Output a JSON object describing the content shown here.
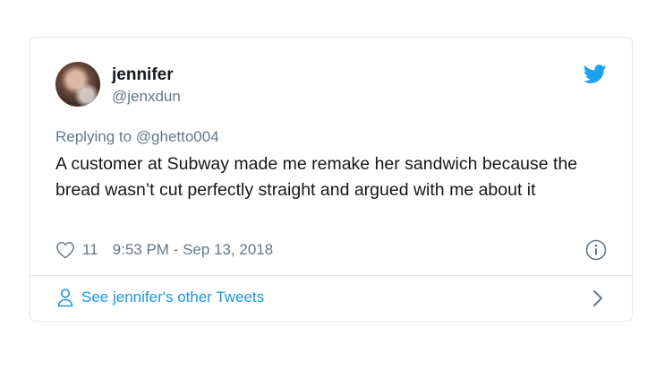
{
  "user": {
    "name": "jennifer",
    "handle": "@jenxdun"
  },
  "tweet": {
    "reply_prefix": "Replying to ",
    "reply_handle": "@ghetto004",
    "text": "A customer at Subway made me remake her sandwich because the bread wasn’t cut perfectly straight and argued with me about it",
    "likes": "11",
    "timestamp": "9:53 PM - Sep 13, 2018"
  },
  "footer": {
    "see_more": "See jennifer's other Tweets"
  },
  "colors": {
    "twitter_blue": "#1da1f2",
    "link_blue": "#1b95e0",
    "secondary": "#657786",
    "border": "#e1e8ed"
  },
  "icons": [
    "twitter-bird-icon",
    "heart-icon",
    "info-icon",
    "person-icon",
    "chevron-right-icon"
  ]
}
